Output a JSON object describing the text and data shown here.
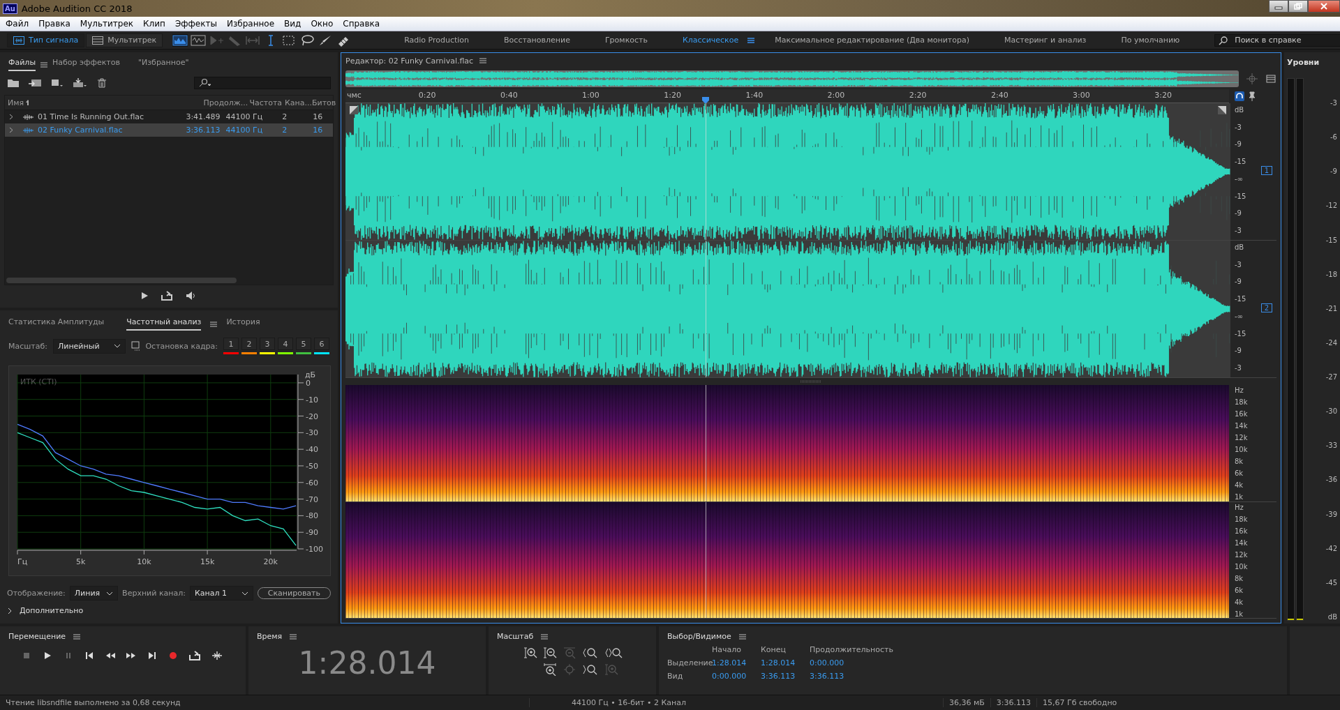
{
  "window": {
    "title": "Adobe Audition CC 2018",
    "app_badge": "Au"
  },
  "menu": [
    "Файл",
    "Правка",
    "Мультитрек",
    "Клип",
    "Эффекты",
    "Избранное",
    "Вид",
    "Окно",
    "Справка"
  ],
  "modes": [
    {
      "label": "Тип сигнала",
      "selected": true
    },
    {
      "label": "Мультитрек",
      "selected": false
    }
  ],
  "workspaces": [
    {
      "label": "Radio Production",
      "selected": false
    },
    {
      "label": "Восстановление",
      "selected": false
    },
    {
      "label": "Громкость",
      "selected": false
    },
    {
      "label": "Классическое",
      "selected": true
    },
    {
      "label": "Максимальное редактирование (Два монитора)",
      "selected": false
    },
    {
      "label": "Мастеринг и анализ",
      "selected": false
    },
    {
      "label": "По умолчанию",
      "selected": false
    }
  ],
  "help_search": {
    "placeholder": "Поиск в справке"
  },
  "files_panel": {
    "tabs": [
      {
        "label": "Файлы",
        "selected": true
      },
      {
        "label": "Набор эффектов",
        "selected": false
      },
      {
        "label": "\"Избранное\"",
        "selected": false
      }
    ],
    "columns": [
      "Имя",
      "Продолж...",
      "Частота",
      "Кана...",
      "Битов"
    ],
    "rows": [
      {
        "name": "01 Time Is Running Out.flac",
        "duration": "3:41.489",
        "rate": "44100 Гц",
        "channels": "2",
        "bits": "16",
        "selected": false
      },
      {
        "name": "02 Funky Carnival.flac",
        "duration": "3:36.113",
        "rate": "44100 Гц",
        "channels": "2",
        "bits": "16",
        "selected": true
      }
    ]
  },
  "analysis_panel": {
    "tabs": [
      {
        "label": "Статистика Амплитуды",
        "selected": false
      },
      {
        "label": "Частотный анализ",
        "selected": true
      },
      {
        "label": "История",
        "selected": false
      }
    ],
    "scale_label": "Масштаб:",
    "scale_value": "Линейный",
    "freeze_label": "Остановка кадра:",
    "freeze_slots": [
      {
        "label": "1",
        "color": "#ff0000"
      },
      {
        "label": "2",
        "color": "#ff8000"
      },
      {
        "label": "3",
        "color": "#ffff00"
      },
      {
        "label": "4",
        "color": "#80ff00"
      },
      {
        "label": "5",
        "color": "#40c040"
      },
      {
        "label": "6",
        "color": "#00e5ff"
      }
    ],
    "chart_caption": "ИТК (CTI)",
    "chart_data": {
      "type": "line",
      "ylabel": "дБ",
      "grid": true,
      "x": [
        0,
        1000,
        2000,
        3000,
        4000,
        5000,
        6000,
        7000,
        8000,
        9000,
        10000,
        11000,
        12000,
        13000,
        14000,
        15000,
        16000,
        17000,
        18000,
        19000,
        20000,
        21000,
        22000
      ],
      "series": [
        {
          "color": "#4f7bff",
          "values": [
            -25,
            -28,
            -32,
            -42,
            -46,
            -50,
            -52,
            -55,
            -56,
            -58,
            -60,
            -62,
            -64,
            -66,
            -68,
            -70,
            -70,
            -72,
            -72,
            -74,
            -75,
            -76,
            -74
          ]
        },
        {
          "color": "#2fe0c0",
          "values": [
            -30,
            -33,
            -36,
            -46,
            -52,
            -56,
            -56,
            -58,
            -62,
            -65,
            -66,
            -68,
            -70,
            -72,
            -75,
            -76,
            -75,
            -80,
            -83,
            -82,
            -86,
            -88,
            -98
          ]
        }
      ],
      "xlim": [
        0,
        22050
      ],
      "ylim": [
        -100,
        5
      ],
      "xticks": [
        {
          "value": 0,
          "label": "Гц"
        },
        {
          "value": 5000,
          "label": "5k"
        },
        {
          "value": 10000,
          "label": "10k"
        },
        {
          "value": 15000,
          "label": "15k"
        },
        {
          "value": 20000,
          "label": "20k"
        }
      ],
      "yticks": [
        0,
        -10,
        -20,
        -30,
        -40,
        -50,
        -60,
        -70,
        -80,
        -90,
        -100
      ]
    },
    "display_label": "Отображение:",
    "display_value": "Линия",
    "channel_label": "Верхний канал:",
    "channel_value": "Канал 1",
    "scan_button": "Сканировать",
    "advanced": {
      "label": "Дополнительно",
      "expanded": false
    }
  },
  "editor": {
    "title": "Редактор: 02 Funky Carnival.flac",
    "ruler_unit": "чмс",
    "ruler_labels": [
      "0:20",
      "0:40",
      "1:00",
      "1:20",
      "1:40",
      "2:00",
      "2:20",
      "2:40",
      "3:00",
      "3:20"
    ],
    "channels": [
      {
        "badge": "1",
        "scale": [
          "dB",
          "-3",
          "-9",
          "-15",
          "-∞",
          "-15",
          "-9",
          "-3"
        ],
        "spectrum_scale": [
          "Hz",
          "18k",
          "16k",
          "14k",
          "12k",
          "10k",
          "8k",
          "6k",
          "4k",
          "1k"
        ]
      },
      {
        "badge": "2",
        "scale": [
          "dB",
          "-3",
          "-9",
          "-15",
          "-∞",
          "-15",
          "-9",
          "-3"
        ],
        "spectrum_scale": [
          "Hz",
          "18k",
          "16k",
          "14k",
          "12k",
          "10k",
          "8k",
          "6k",
          "4k",
          "1k"
        ]
      }
    ]
  },
  "levels": {
    "title": "Уровни",
    "scale": [
      "-3",
      "-6",
      "-9",
      "-12",
      "-15",
      "-18",
      "-21",
      "-24",
      "-27",
      "-30",
      "-33",
      "-36",
      "-39",
      "-42",
      "-45",
      "dB"
    ]
  },
  "transport": {
    "title": "Перемещение"
  },
  "time": {
    "title": "Время",
    "value": "1:28.014"
  },
  "zoom": {
    "title": "Масштаб"
  },
  "selection": {
    "title": "Выбор/Видимое",
    "columns": [
      "Начало",
      "Конец",
      "Продолжительность"
    ],
    "rows": [
      {
        "label": "Выделение",
        "values": [
          "1:28.014",
          "1:28.014",
          "0:00.000"
        ]
      },
      {
        "label": "Вид",
        "values": [
          "0:00.000",
          "3:36.113",
          "3:36.113"
        ]
      }
    ]
  },
  "status_bar": {
    "message": "Чтение libsndfile выполнено за 0,68 секунд",
    "format": "44100 Гц • 16-бит • 2 Канал",
    "size": "36,36 мБ",
    "duration": "3:36.113",
    "free": "15,67 Гб свободно"
  }
}
